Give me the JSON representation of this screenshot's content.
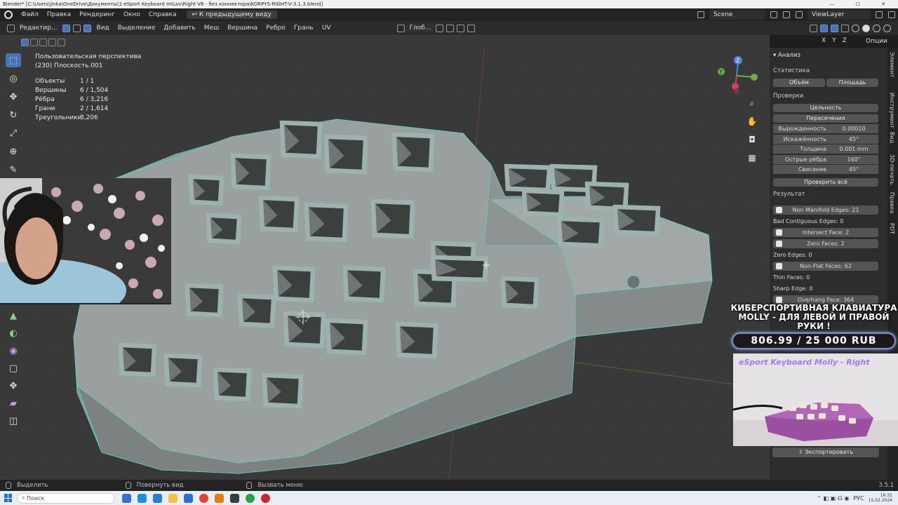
{
  "window": {
    "title": "Blender* [C:\\Users\\jinka\\OneDrive\\Документы\\1-eSport Keyboard ImLav\\Right V8 - без коннектора\\KORPYS-RIGHT-V-3.1.3.blend]"
  },
  "menu": {
    "items": [
      "Файл",
      "Правка",
      "Рендеринг",
      "Окно",
      "Справка"
    ],
    "back_button": "К предыдущему виду",
    "scene": "Scene",
    "view_layer": "ViewLayer"
  },
  "header": {
    "mode": "Редактир...",
    "menus": [
      "Вид",
      "Выделение",
      "Добавить",
      "Меш",
      "Вершина",
      "Ребро",
      "Грань",
      "UV"
    ],
    "transform_orientation": "Глоб...",
    "options": "Опции",
    "mirror_axes": [
      "X",
      "Y",
      "Z"
    ]
  },
  "viewport_info": {
    "view_name": "Пользовательская перспектива",
    "object_name": "(230) Плоскость.001",
    "stats": [
      {
        "label": "Объекты",
        "value": "1 / 1"
      },
      {
        "label": "Вершины",
        "value": "6 / 1,504"
      },
      {
        "label": "Рёбра",
        "value": "6 / 3,216"
      },
      {
        "label": "Грани",
        "value": "2 / 1,614"
      },
      {
        "label": "Треугольники",
        "value": "3,206"
      }
    ]
  },
  "panel": {
    "title": "Анализ",
    "statistics_label": "Статистика",
    "volume_btn": "Объём",
    "area_btn": "Площадь",
    "checks_label": "Проверки",
    "integrity_btn": "Цельность",
    "intersections_btn": "Пересечения",
    "props": [
      {
        "label": "Вырожденность",
        "value": "0.00010"
      },
      {
        "label": "Искажённость",
        "value": "45°"
      },
      {
        "label": "Толщина",
        "value": "0.001 mm"
      },
      {
        "label": "Острые рёбра",
        "value": "160°"
      },
      {
        "label": "Свисание",
        "value": "45°"
      }
    ],
    "check_all_btn": "Проверить всё",
    "result_label": "Результат",
    "results": [
      {
        "text": "Non Manifold Edges: 21",
        "button": true
      },
      {
        "text": "Bad Contiguous Edges: 0",
        "button": false
      },
      {
        "text": "Intersect Face: 2",
        "button": true
      },
      {
        "text": "Zero Faces: 2",
        "button": true
      },
      {
        "text": "Zero Edges: 0",
        "button": false
      },
      {
        "text": "Non-Flat Faces: 62",
        "button": true
      },
      {
        "text": "Thin Faces: 0",
        "button": false
      },
      {
        "text": "Sharp Edge: 0",
        "button": false
      },
      {
        "text": "Overhang Face: 364",
        "button": true
      }
    ],
    "export_btn": "Экспортировать"
  },
  "side_tabs": [
    "Элемент",
    "Инструмент",
    "Вид",
    "3D-печать",
    "Правка",
    "PDT"
  ],
  "overlay": {
    "title": "КИБЕРСПОРТИВНАЯ КЛАВИАТУРА MOLLY - ДЛЯ ЛЕВОЙ И ПРАВОЙ РУКИ !",
    "goal": "806.99  /  25  000  RUB",
    "promo_title": "eSport Keyboard Molly - Right"
  },
  "statusbar": {
    "select": "Выделить",
    "rotate": "Повернуть вид",
    "menu": "Вызвать меню",
    "version": "3.5.1"
  },
  "taskbar": {
    "search": "Поиск",
    "lang": "РУС",
    "time": "16:31",
    "date": "15.02.2024"
  }
}
